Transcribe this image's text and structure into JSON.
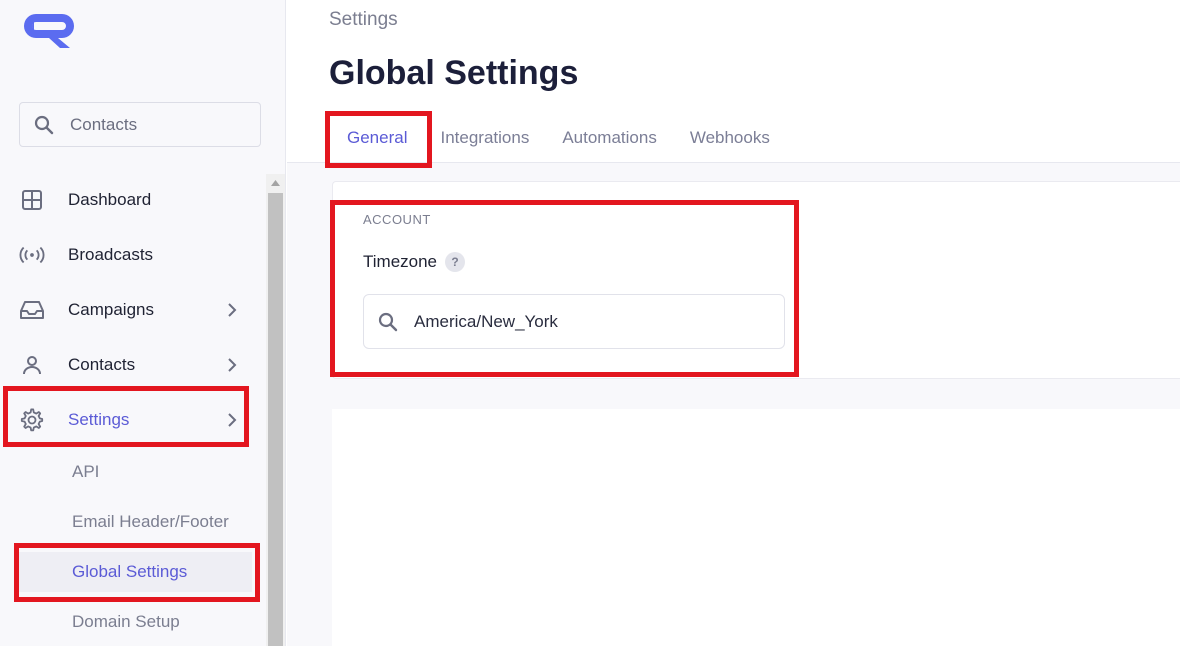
{
  "sidebar": {
    "logo_icon": "cr-logo",
    "search": {
      "value": "Contacts",
      "icon": "search-icon"
    },
    "items": [
      {
        "label": "Dashboard",
        "icon": "grid-icon"
      },
      {
        "label": "Broadcasts",
        "icon": "broadcast-icon"
      },
      {
        "label": "Campaigns",
        "icon": "inbox-icon"
      },
      {
        "label": "Contacts",
        "icon": "user-icon"
      },
      {
        "label": "Settings",
        "icon": "gear-icon",
        "active": true
      }
    ],
    "sub_items": [
      {
        "label": "API"
      },
      {
        "label": "Email Header/Footer"
      },
      {
        "label": "Global Settings",
        "active": true
      },
      {
        "label": "Domain Setup"
      }
    ]
  },
  "main": {
    "breadcrumb": "Settings",
    "title": "Global Settings",
    "tabs": [
      {
        "label": "General",
        "active": true
      },
      {
        "label": "Integrations"
      },
      {
        "label": "Automations"
      },
      {
        "label": "Webhooks"
      }
    ],
    "section_label": "ACCOUNT",
    "timezone": {
      "label": "Timezone",
      "help": "?",
      "value": "America/New_York"
    }
  },
  "colors": {
    "accent": "#5b5bd6",
    "highlight": "#e3161f",
    "logo": "#5b6cf0"
  }
}
